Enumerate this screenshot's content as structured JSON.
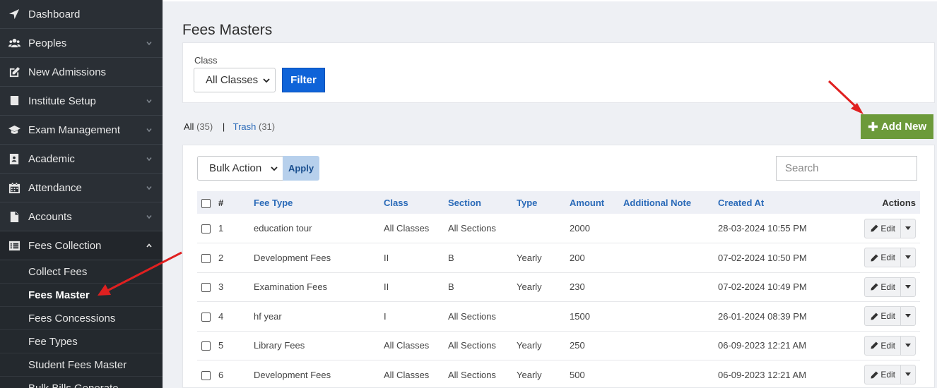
{
  "sidebar": {
    "items": [
      {
        "label": "Dashboard",
        "icon": "paper-plane-icon",
        "chevron": false
      },
      {
        "label": "Peoples",
        "icon": "users-icon",
        "chevron": true
      },
      {
        "label": "New Admissions",
        "icon": "edit-icon",
        "chevron": false
      },
      {
        "label": "Institute Setup",
        "icon": "book-icon",
        "chevron": true
      },
      {
        "label": "Exam Management",
        "icon": "graduation-cap-icon",
        "chevron": true
      },
      {
        "label": "Academic",
        "icon": "id-card-icon",
        "chevron": true
      },
      {
        "label": "Attendance",
        "icon": "calendar-icon",
        "chevron": true
      },
      {
        "label": "Accounts",
        "icon": "file-icon",
        "chevron": true
      },
      {
        "label": "Fees Collection",
        "icon": "list-alt-icon",
        "chevron": true,
        "expanded": true
      }
    ],
    "fees_submenu": [
      {
        "label": "Collect Fees"
      },
      {
        "label": "Fees Master",
        "current": true
      },
      {
        "label": "Fees Concessions"
      },
      {
        "label": "Fee Types"
      },
      {
        "label": "Student Fees Master"
      },
      {
        "label": "Bulk Bills Generate"
      }
    ]
  },
  "page": {
    "title": "Fees Masters"
  },
  "filter": {
    "class_label": "Class",
    "class_selected": "All Classes",
    "filter_button": "Filter"
  },
  "counts": {
    "all_label": "All",
    "all_count": "(35)",
    "separator": "|",
    "trash_label": "Trash",
    "trash_count": "(31)"
  },
  "add_new": {
    "label": "Add New"
  },
  "toolbar": {
    "bulk_selected": "Bulk Action",
    "apply_label": "Apply",
    "search_placeholder": "Search"
  },
  "table": {
    "headers": [
      "#",
      "Fee Type",
      "Class",
      "Section",
      "Type",
      "Amount",
      "Additional Note",
      "Created At",
      "Actions"
    ],
    "rows": [
      {
        "num": "1",
        "fee_type": "education tour",
        "class": "All Classes",
        "section": "All Sections",
        "type": "",
        "amount": "2000",
        "note": "",
        "created": "28-03-2024 10:55 PM"
      },
      {
        "num": "2",
        "fee_type": "Development Fees",
        "class": "II",
        "section": "B",
        "type": "Yearly",
        "amount": "200",
        "note": "",
        "created": "07-02-2024 10:50 PM"
      },
      {
        "num": "3",
        "fee_type": "Examination Fees",
        "class": "II",
        "section": "B",
        "type": "Yearly",
        "amount": "230",
        "note": "",
        "created": "07-02-2024 10:49 PM"
      },
      {
        "num": "4",
        "fee_type": "hf year",
        "class": "I",
        "section": "All Sections",
        "type": "",
        "amount": "1500",
        "note": "",
        "created": "26-01-2024 08:39 PM"
      },
      {
        "num": "5",
        "fee_type": "Library Fees",
        "class": "All Classes",
        "section": "All Sections",
        "type": "Yearly",
        "amount": "250",
        "note": "",
        "created": "06-09-2023 12:21 AM"
      },
      {
        "num": "6",
        "fee_type": "Development Fees",
        "class": "All Classes",
        "section": "All Sections",
        "type": "Yearly",
        "amount": "500",
        "note": "",
        "created": "06-09-2023 12:21 AM"
      }
    ],
    "edit_label": "Edit"
  },
  "colors": {
    "sidebar_bg": "#2a2f35",
    "primary_blue": "#0f63d8",
    "add_new_green": "#6c9a3a",
    "annotation_red": "#e02020"
  }
}
